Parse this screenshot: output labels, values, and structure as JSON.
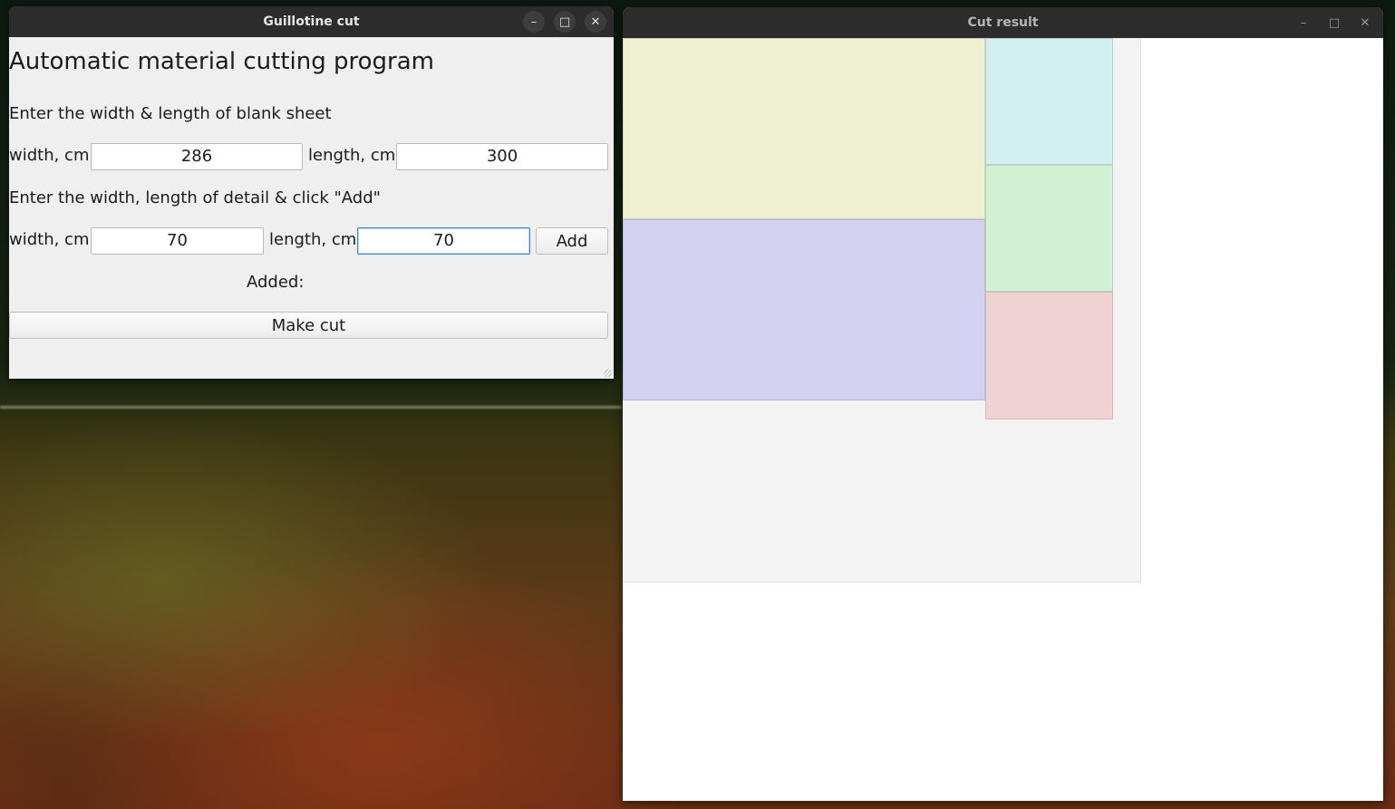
{
  "main_window": {
    "title": "Guillotine cut",
    "controls": {
      "minimize": "–",
      "maximize": "□",
      "close": "✕"
    },
    "heading": "Automatic material cutting program",
    "sheet_prompt": "Enter the width & length of blank sheet",
    "sheet_width_label": "width, cm",
    "sheet_width_value": "286",
    "sheet_length_label": "length, cm",
    "sheet_length_value": "300",
    "detail_prompt": "Enter the width, length of detail & click \"Add\"",
    "detail_width_label": "width, cm",
    "detail_width_value": "70",
    "detail_length_label": "length, cm",
    "detail_length_value": "70",
    "add_button": "Add",
    "added_label": "Added:",
    "make_cut_button": "Make cut"
  },
  "result_window": {
    "title": "Cut result",
    "controls": {
      "minimize": "–",
      "maximize": "□",
      "close": "✕"
    },
    "pieces": [
      {
        "name": "piece-yellow",
        "color": "#efefd2"
      },
      {
        "name": "piece-blue",
        "color": "#d2d2f0"
      },
      {
        "name": "piece-cyan",
        "color": "#d2f0f0"
      },
      {
        "name": "piece-green",
        "color": "#d2f0d2"
      },
      {
        "name": "piece-red",
        "color": "#f0d2d2"
      }
    ]
  }
}
